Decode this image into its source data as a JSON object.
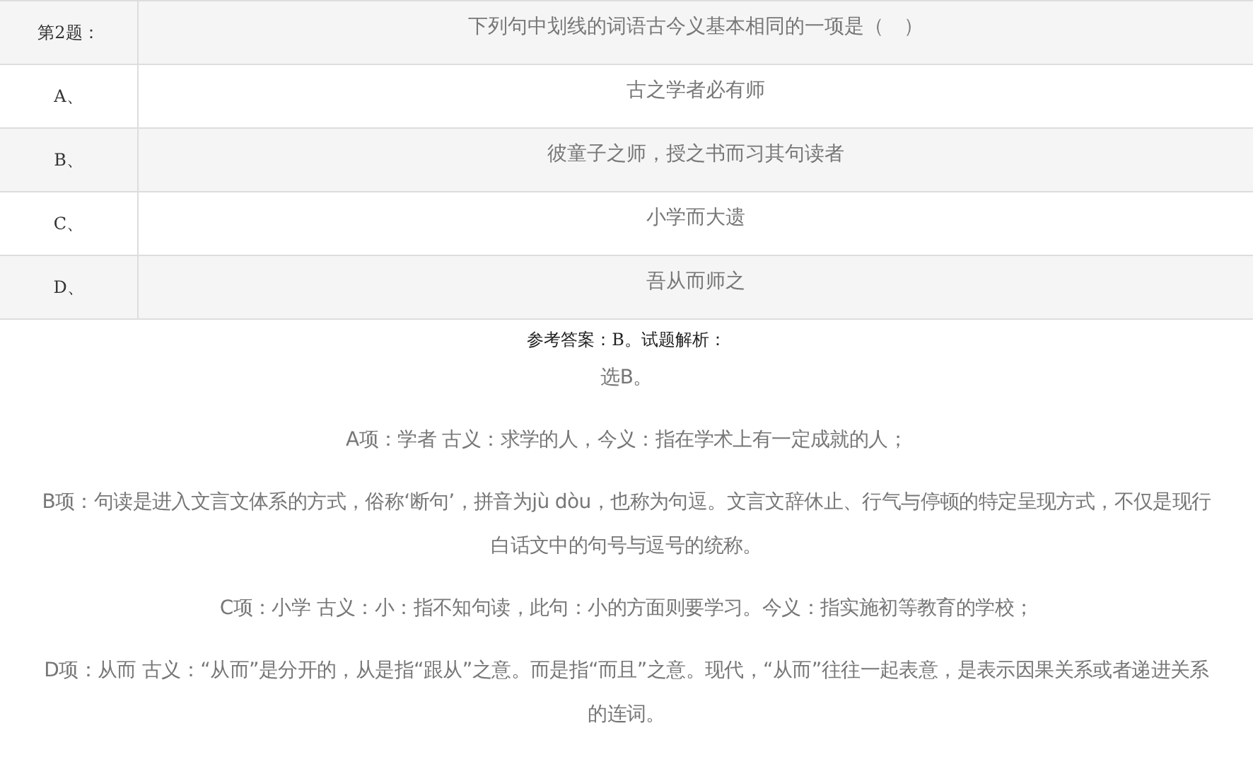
{
  "question": {
    "number": "第2题：",
    "text": "下列句中划线的词语古今义基本相同的一项是（　）"
  },
  "options": [
    {
      "label": "A、",
      "text": "古之学者必有师"
    },
    {
      "label": "B、",
      "text": "彼童子之师，授之书而习其句读者"
    },
    {
      "label": "C、",
      "text": "小学而大遗"
    },
    {
      "label": "D、",
      "text": "吾从而师之"
    }
  ],
  "answer_heading": "参考答案：B。试题解析：",
  "explanation": [
    "选B。",
    "A项：学者 古义：求学的人，今义：指在学术上有一定成就的人；",
    "B项：句读是进入文言文体系的方式，俗称‘断句’，拼音为jù dòu，也称为句逗。文言文辞休止、行气与停顿的特定呈现方式，不仅是现行白话文中的句号与逗号的统称。",
    "C项：小学 古义：小：指不知句读，此句：小的方面则要学习。今义：指实施初等教育的学校；",
    "D项：从而 古义：“从而”是分开的，从是指“跟从”之意。而是指“而且”之意。现代，“从而”往往一起表意，是表示因果关系或者递进关系的连词。"
  ]
}
